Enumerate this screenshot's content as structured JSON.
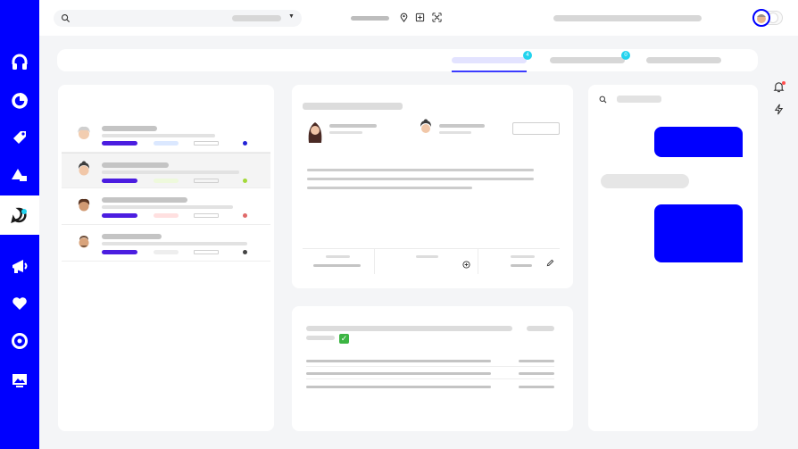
{
  "sidebar": {
    "items": [
      {
        "name": "headset"
      },
      {
        "name": "chart"
      },
      {
        "name": "tag"
      },
      {
        "name": "shapes"
      },
      {
        "name": "messages",
        "active": true
      },
      {
        "name": "megaphone"
      },
      {
        "name": "heart"
      },
      {
        "name": "target"
      },
      {
        "name": "image"
      }
    ]
  },
  "colors": {
    "brand": "#0000ff",
    "accent_purple": "#4b1de0",
    "badge": "#22d3ee",
    "status_blue": "#2323d6",
    "status_green": "#a3d93a",
    "status_red": "#e06a6a",
    "status_dark": "#444444",
    "check_green": "#3cb543"
  },
  "tabs": [
    {
      "badge": "4",
      "active": true
    },
    {
      "badge": "0"
    },
    {}
  ],
  "conversations": [
    {
      "status_color": "#2323d6",
      "tag_color": "#dbe8ff"
    },
    {
      "status_color": "#a3d93a",
      "tag_color": "#eef9dc",
      "selected": true
    },
    {
      "status_color": "#e06a6a",
      "tag_color": "#ffe0e0"
    },
    {
      "status_color": "#444444",
      "tag_color": "#eeeeee"
    }
  ]
}
